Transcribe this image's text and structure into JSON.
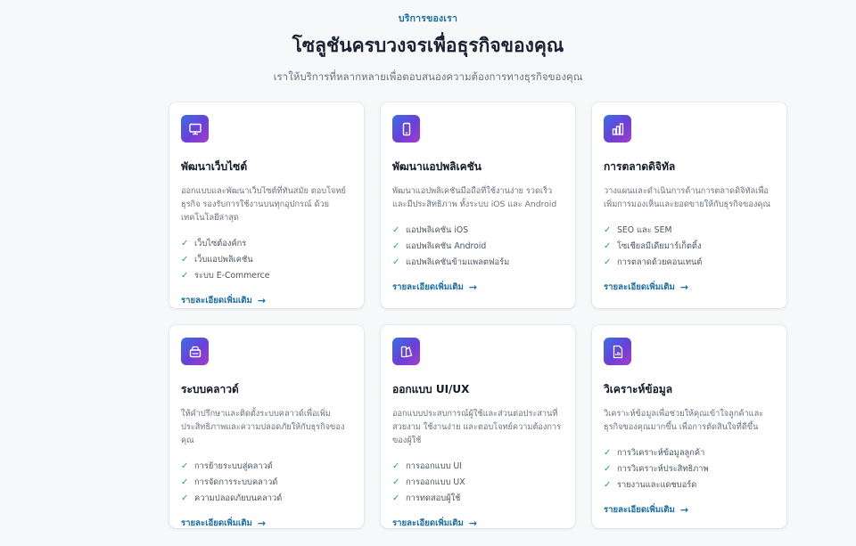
{
  "section": {
    "eyebrow": "บริการของเรา",
    "title": "โซลูชันครบวงจรเพื่อธุรกิจของคุณ",
    "subtitle": "เราให้บริการที่หลากหลายเพื่อตอบสนองความต้องการทางธุรกิจของคุณ"
  },
  "more_label": "รายละเอียดเพิ่มเติม",
  "accent_color": "#1c6ea4",
  "cards": [
    {
      "icon": "monitor-icon",
      "title": "พัฒนาเว็บไซต์",
      "desc": "ออกแบบและพัฒนาเว็บไซต์ที่ทันสมัย ตอบโจทย์ธุรกิจ รองรับการใช้งานบนทุกอุปกรณ์ ด้วยเทคโนโลยีล่าสุด",
      "features": [
        "เว็บไซต์องค์กร",
        "เว็บแอปพลิเคชัน",
        "ระบบ E-Commerce"
      ]
    },
    {
      "icon": "smartphone-icon",
      "title": "พัฒนาแอปพลิเคชัน",
      "desc": "พัฒนาแอปพลิเคชันมือถือที่ใช้งานง่าย รวดเร็ว และมีประสิทธิภาพ ทั้งระบบ iOS และ Android",
      "features": [
        "แอปพลิเคชัน iOS",
        "แอปพลิเคชัน Android",
        "แอปพลิเคชันข้ามแพลตฟอร์ม"
      ]
    },
    {
      "icon": "bar-chart-icon",
      "title": "การตลาดดิจิทัล",
      "desc": "วางแผนและดำเนินการด้านการตลาดดิจิทัลเพื่อเพิ่มการมองเห็นและยอดขายให้กับธุรกิจของคุณ",
      "features": [
        "SEO และ SEM",
        "โซเชียลมีเดียมาร์เก็ตติ้ง",
        "การตลาดด้วยคอนเทนต์"
      ]
    },
    {
      "icon": "cloud-server-icon",
      "title": "ระบบคลาวด์",
      "desc": "ให้คำปรึกษาและติดตั้งระบบคลาวด์เพื่อเพิ่มประสิทธิภาพและความปลอดภัยให้กับธุรกิจของคุณ",
      "features": [
        "การย้ายระบบสู่คลาวด์",
        "การจัดการระบบคลาวด์",
        "ความปลอดภัยบนคลาวด์"
      ]
    },
    {
      "icon": "design-icon",
      "title": "ออกแบบ UI/UX",
      "desc": "ออกแบบประสบการณ์ผู้ใช้และส่วนต่อประสานที่สวยงาม ใช้งานง่าย และตอบโจทย์ความต้องการของผู้ใช้",
      "features": [
        "การออกแบบ UI",
        "การออกแบบ UX",
        "การทดสอบผู้ใช้"
      ]
    },
    {
      "icon": "report-icon",
      "title": "วิเคราะห์ข้อมูล",
      "desc": "วิเคราะห์ข้อมูลเพื่อช่วยให้คุณเข้าใจลูกค้าและธุรกิจของคุณมากขึ้น เพื่อการตัดสินใจที่ดีขึ้น",
      "features": [
        "การวิเคราะห์ข้อมูลลูกค้า",
        "การวิเคราะห์ประสิทธิภาพ",
        "รายงานและแดชบอร์ด"
      ]
    }
  ]
}
